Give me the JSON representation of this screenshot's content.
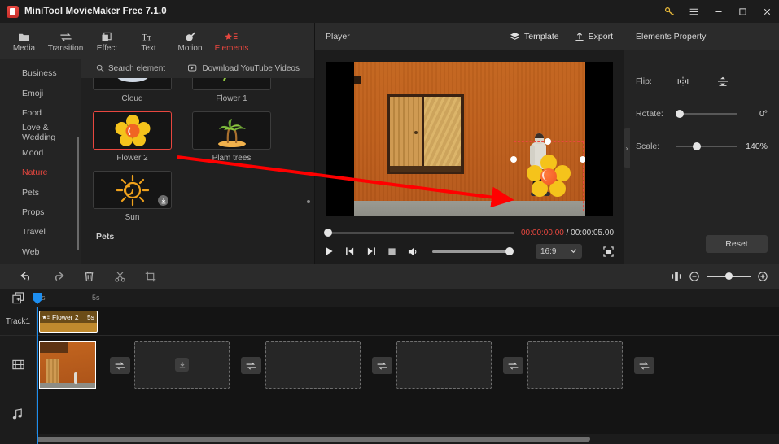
{
  "window": {
    "title": "MiniTool MovieMaker Free 7.1.0",
    "buttons": {
      "key": "key-icon",
      "menu": "hamburger-icon",
      "minimize": "–",
      "maximize": "▢",
      "close": "✕"
    }
  },
  "tabs": [
    {
      "label": "Media",
      "icon": "folder-icon",
      "active": false
    },
    {
      "label": "Transition",
      "icon": "transition-icon",
      "active": false
    },
    {
      "label": "Effect",
      "icon": "effect-icon",
      "active": false
    },
    {
      "label": "Text",
      "icon": "text-icon",
      "active": false
    },
    {
      "label": "Motion",
      "icon": "motion-icon",
      "active": false
    },
    {
      "label": "Elements",
      "icon": "elements-icon",
      "active": true
    }
  ],
  "categories": [
    {
      "label": "Business",
      "active": false
    },
    {
      "label": "Emoji",
      "active": false
    },
    {
      "label": "Food",
      "active": false
    },
    {
      "label": "Love & Wedding",
      "active": false
    },
    {
      "label": "Mood",
      "active": false
    },
    {
      "label": "Nature",
      "active": true
    },
    {
      "label": "Pets",
      "active": false
    },
    {
      "label": "Props",
      "active": false
    },
    {
      "label": "Travel",
      "active": false
    },
    {
      "label": "Web",
      "active": false
    }
  ],
  "element_panel": {
    "search_placeholder": "Search element",
    "download_label": "Download YouTube Videos",
    "row_partial": [
      {
        "label": "Cloud"
      },
      {
        "label": "Flower 1"
      }
    ],
    "row_main": [
      {
        "label": "Flower 2",
        "selected": true,
        "downloadable": false
      },
      {
        "label": "Plam trees",
        "selected": false,
        "downloadable": false
      }
    ],
    "row_last": [
      {
        "label": "Sun",
        "selected": false,
        "downloadable": true
      }
    ],
    "next_section": "Pets"
  },
  "player": {
    "title": "Player",
    "template_label": "Template",
    "export_label": "Export",
    "current_time": "00:00:00.00",
    "separator": "/",
    "total_time": "00:00:05.00",
    "aspect_ratio": "16:9",
    "controls": [
      "play-button",
      "prev-frame-button",
      "next-frame-button",
      "stop-button",
      "volume-button"
    ]
  },
  "properties": {
    "title": "Elements Property",
    "flip_label": "Flip:",
    "rotate_label": "Rotate:",
    "rotate_value": "0°",
    "scale_label": "Scale:",
    "scale_value": "140%",
    "reset_label": "Reset"
  },
  "timeline": {
    "toolbar": [
      "undo-icon",
      "redo-icon",
      "delete-icon",
      "split-icon",
      "crop-icon"
    ],
    "ruler": {
      "start": "0s",
      "mid": "5s"
    },
    "track_label": "Track1",
    "clip": {
      "name": "Flower 2",
      "duration": "5s"
    },
    "video_track_icon": "film-icon",
    "audio_track_icon": "music-note-icon",
    "add_media_icon": "add-media-icon"
  },
  "colors": {
    "accent": "#e8473f",
    "playhead": "#1d8ef0",
    "clip": "#c08a2e",
    "bg": "#1c1c1c"
  }
}
